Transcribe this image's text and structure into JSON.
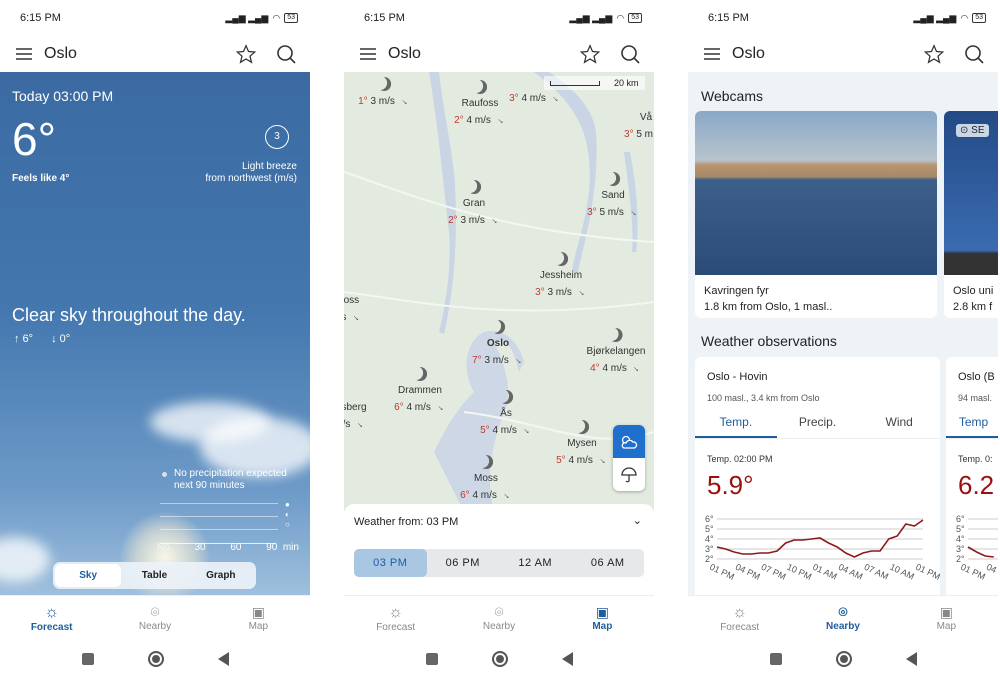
{
  "status": {
    "time": "6:15 PM",
    "battery": "53"
  },
  "header": {
    "city": "Oslo"
  },
  "nav": {
    "forecast": "Forecast",
    "nearby": "Nearby",
    "map": "Map"
  },
  "forecast": {
    "time": "Today 03:00 PM",
    "temp": "6°",
    "feels": "Feels like 4°",
    "wind_speed": "3",
    "wind_desc": "Light breeze",
    "wind_dir": "from northwest (m/s)",
    "summary": "Clear sky throughout the day.",
    "high": "↑ 6°",
    "low": "↓ 0°",
    "precip_line1": "No precipitation expected",
    "precip_line2": "next 90 minutes",
    "precip_ticks": [
      "No",
      "30",
      "60",
      "90",
      "min"
    ],
    "tabs": [
      "Sky",
      "Table",
      "Graph"
    ],
    "active_tab": "Sky"
  },
  "map": {
    "scale": "20 km",
    "markers": [
      {
        "name": "",
        "temp": "1°",
        "wind": "3 m/s",
        "icon": "moon"
      },
      {
        "name": "Raufoss",
        "temp": "2°",
        "wind": "4 m/s",
        "icon": "moon"
      },
      {
        "name": "",
        "temp": "3°",
        "wind": "4 m/s",
        "icon": ""
      },
      {
        "name": "Vå",
        "temp": "3°",
        "wind": "5 m",
        "icon": ""
      },
      {
        "name": "Gran",
        "temp": "2°",
        "wind": "3 m/s",
        "icon": "partly-cloudy-night"
      },
      {
        "name": "Sand",
        "temp": "3°",
        "wind": "5 m/s",
        "icon": "partly-cloudy-night"
      },
      {
        "name": "Jessheim",
        "temp": "3°",
        "wind": "3 m/s",
        "icon": "moon"
      },
      {
        "name": "foss",
        "temp": "",
        "wind": "/s",
        "icon": ""
      },
      {
        "name": "Oslo",
        "temp": "7°",
        "wind": "3 m/s",
        "icon": "moon"
      },
      {
        "name": "Bjørkelangen",
        "temp": "4°",
        "wind": "4 m/s",
        "icon": "moon"
      },
      {
        "name": "Drammen",
        "temp": "6°",
        "wind": "4 m/s",
        "icon": "moon"
      },
      {
        "name": "sberg",
        "temp": "",
        "wind": "/s",
        "icon": ""
      },
      {
        "name": "Ås",
        "temp": "5°",
        "wind": "4 m/s",
        "icon": "moon"
      },
      {
        "name": "Mysen",
        "temp": "5°",
        "wind": "4 m/s",
        "icon": "moon"
      },
      {
        "name": "Moss",
        "temp": "6°",
        "wind": "4 m/s",
        "icon": "moon"
      }
    ],
    "weather_from": "Weather from: 03 PM",
    "times": [
      "03 PM",
      "06 PM",
      "12 AM",
      "06 AM"
    ],
    "active_time": "03 PM"
  },
  "nearby": {
    "webcams_title": "Webcams",
    "webcams": [
      {
        "name": "Kavringen fyr",
        "sub": "1.8 km from Oslo, 1 masl.."
      },
      {
        "name": "Oslo uni",
        "sub": "2.8 km f",
        "badge": "SE"
      }
    ],
    "obs_title": "Weather observations",
    "stations": [
      {
        "name": "Oslo - Hovin",
        "sub": "100 masl., 3.4 km from Oslo",
        "tabs": [
          "Temp.",
          "Precip.",
          "Wind"
        ],
        "label": "Temp. 02:00 PM",
        "value": "5.9°"
      },
      {
        "name": "Oslo (B",
        "sub": "94 masl.",
        "tabs": [
          "Temp"
        ],
        "label": "Temp. 0:",
        "value": "6.2"
      }
    ]
  },
  "chart_data": [
    {
      "type": "line",
      "x": [
        "01 PM",
        "04 PM",
        "07 PM",
        "10 PM",
        "01 AM",
        "04 AM",
        "07 AM",
        "10 AM",
        "01 PM"
      ],
      "yticks": [
        "6°",
        "5°",
        "4°",
        "3°",
        "2°"
      ],
      "ylim": [
        2,
        6
      ],
      "grid": true,
      "color": "#8b1a1a",
      "values": [
        3.2,
        3.0,
        2.7,
        2.5,
        2.5,
        2.6,
        2.6,
        2.8,
        3.6,
        3.9,
        3.9,
        4.0,
        4.1,
        3.6,
        3.2,
        2.6,
        2.2,
        2.6,
        2.8,
        2.8,
        4.0,
        4.3,
        5.5,
        5.3,
        5.9
      ]
    },
    {
      "type": "line",
      "x": [
        "01 PM",
        "04"
      ],
      "yticks": [
        "6°",
        "5°",
        "4°",
        "3°",
        "2°"
      ],
      "ylim": [
        2,
        6
      ],
      "grid": true,
      "color": "#8b1a1a",
      "values": [
        3.2,
        2.7,
        2.3,
        2.2
      ]
    }
  ],
  "colors": {
    "accent": "#1f5d9c",
    "temp_red": "#9a1010"
  }
}
